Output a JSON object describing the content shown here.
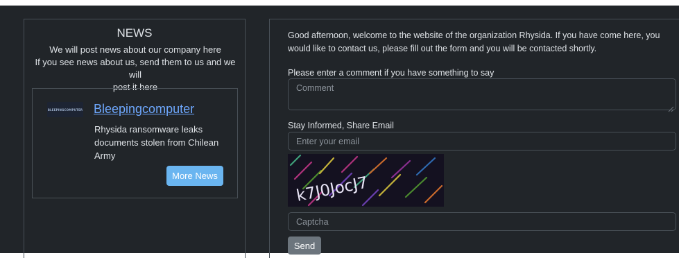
{
  "news": {
    "title": "NEWS",
    "description_line1": "We will post news about our company here",
    "description_line2": "If you see news about us, send them to us and we will",
    "description_line3": "post it here",
    "card": {
      "logo_text": "BLEEPINGCOMPUTER",
      "title": "Bleepingcomputer",
      "text": "Rhysida ransomware leaks documents stolen from Chilean Army",
      "button_label": "More News"
    }
  },
  "form": {
    "greeting": "Good afternoon, welcome to the website of the organization Rhysida. If you have come here, you would like to contact us, please fill out the form and you will be contacted shortly.",
    "comment_label": "Please enter a comment if you have something to say",
    "comment_placeholder": "Comment",
    "email_label": "Stay Informed, Share Email",
    "email_placeholder": "Enter your email",
    "captcha_text": "k7J0JocJ7",
    "captcha_placeholder": "Captcha",
    "send_label": "Send"
  },
  "colors": {
    "background": "#212529",
    "link": "#6ea8fe",
    "more_news_button": "#6ab5f0",
    "send_button": "#6c757d",
    "border": "#495057"
  }
}
